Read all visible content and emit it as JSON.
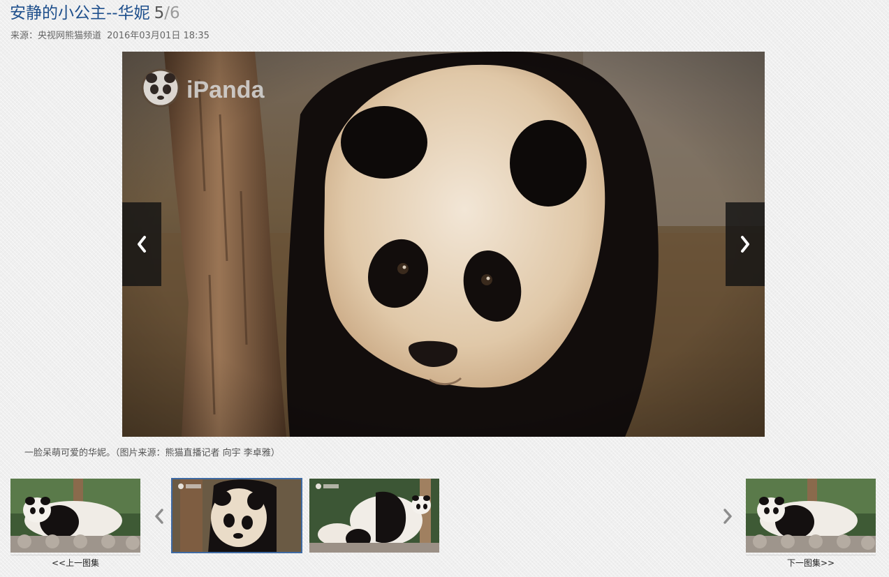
{
  "gallery": {
    "title": "安静的小公主--华妮",
    "current_index": "5",
    "total": "/6",
    "source": "来源：央视网熊猫频道",
    "datetime": "2016年03月01日 18:35",
    "watermark": "iPanda",
    "caption": "一脸呆萌可爱的华妮。（图片来源：熊猫直播记者 向宇 李卓雅）"
  },
  "navigation": {
    "prev_set_label": "<<上一图集",
    "next_set_label": "下一图集>>"
  },
  "icons": {
    "prev_photo": "chevron-left-icon",
    "next_photo": "chevron-right-icon",
    "strip_prev": "chevron-left-icon",
    "strip_next": "chevron-right-icon"
  },
  "colors": {
    "title": "#1e4f8c",
    "counter": "#555555",
    "counter_total": "#9a9a9a",
    "active_thumb_border": "#3e6aa3"
  }
}
